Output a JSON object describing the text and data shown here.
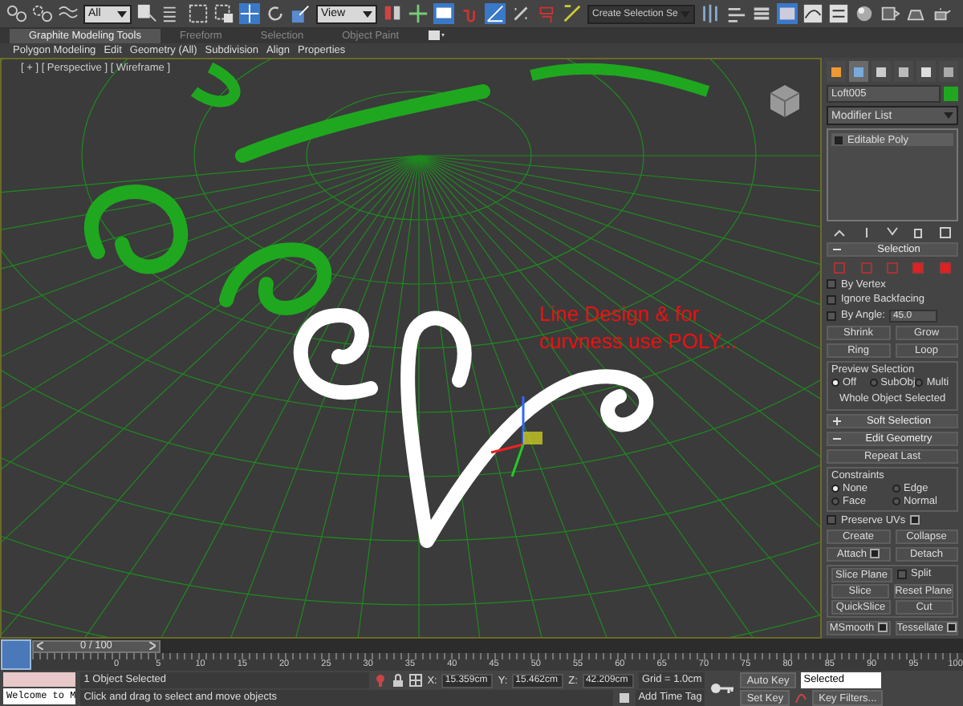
{
  "toolbar": {
    "selection_filter": "All",
    "reference_coordinate": "View",
    "named_selection": "Create Selection Se"
  },
  "ribbon": {
    "tabs": [
      {
        "label": "Graphite Modeling Tools",
        "selected": true
      },
      {
        "label": "Freeform",
        "selected": false
      },
      {
        "label": "Selection",
        "selected": false
      },
      {
        "label": "Object Paint",
        "selected": false
      }
    ],
    "panels": [
      "Polygon Modeling",
      "Edit",
      "Geometry (All)",
      "Subdivision",
      "Align",
      "Properties"
    ]
  },
  "viewport": {
    "label": "[ + ] [ Perspective ] [ Wireframe ]",
    "annotation": "Line Design & for curvness use POLY..."
  },
  "command_panel": {
    "tabs": [
      {
        "selected": false
      },
      {
        "selected": true
      },
      {
        "selected": false
      },
      {
        "selected": false
      },
      {
        "selected": false
      },
      {
        "selected": false
      }
    ],
    "object": {
      "name": "Loft005",
      "color": "#1fa81f"
    },
    "modifier_list": "Modifier List",
    "stack": [
      {
        "label": "Editable Poly",
        "selected": true
      }
    ],
    "selection": {
      "title": "Selection",
      "expanded": true,
      "checks": [
        {
          "label": "By Vertex",
          "checked": false
        },
        {
          "label": "Ignore Backfacing",
          "checked": false
        },
        {
          "label": "By Angle:",
          "checked": false
        }
      ],
      "angle": "45.0",
      "buttons": [
        [
          "Shrink",
          "Grow"
        ],
        [
          "Ring",
          "Loop"
        ]
      ],
      "preview_title": "Preview Selection",
      "preview": [
        {
          "label": "Off",
          "selected": true
        },
        {
          "label": "SubObj",
          "selected": false
        },
        {
          "label": "Multi",
          "selected": false
        }
      ],
      "info": "Whole Object Selected"
    },
    "soft_selection": {
      "title": "Soft Selection",
      "expanded": false
    },
    "edit_geometry": {
      "title": "Edit Geometry",
      "expanded": true,
      "repeat": "Repeat Last",
      "constraints_title": "Constraints",
      "constraints": [
        {
          "label": "None",
          "selected": true
        },
        {
          "label": "Edge",
          "selected": false
        },
        {
          "label": "Face",
          "selected": false
        },
        {
          "label": "Normal",
          "selected": false
        }
      ],
      "preserve_uvs": {
        "label": "Preserve UVs",
        "checked": false
      },
      "rows": [
        [
          {
            "label": "Create",
            "settings": false
          },
          {
            "label": "Collapse",
            "settings": false
          }
        ],
        [
          {
            "label": "Attach",
            "settings": true
          },
          {
            "label": "Detach",
            "settings": false
          }
        ]
      ],
      "slice_plane": "Slice Plane",
      "split": {
        "label": "Split",
        "checked": false
      },
      "slice_rows": [
        [
          "Slice",
          "Reset Plane"
        ],
        [
          "QuickSlice",
          "Cut"
        ]
      ],
      "bottom_row": [
        {
          "label": "MSmooth",
          "settings": true
        },
        {
          "label": "Tessellate",
          "settings": true
        }
      ]
    }
  },
  "timeline": {
    "position": "0 / 100",
    "level": 0,
    "ticks": [
      "0",
      "5",
      "10",
      "15",
      "20",
      "25",
      "30",
      "35",
      "40",
      "45",
      "50",
      "55",
      "60",
      "65",
      "70",
      "75",
      "80",
      "85",
      "90",
      "95",
      "100"
    ]
  },
  "status_bar": {
    "script_listener": "Welcome to M",
    "selection": "1 Object Selected",
    "prompt": "Click and drag to select and move objects",
    "coords": [
      {
        "axis": "X:",
        "value": "15.359cm"
      },
      {
        "axis": "Y:",
        "value": "15.462cm"
      },
      {
        "axis": "Z:",
        "value": "42.209cm"
      }
    ],
    "grid": "Grid = 1.0cm",
    "add_time_tag": "Add Time Tag",
    "auto_key": "Auto Key",
    "key_mode": "Selected",
    "set_key": "Set Key",
    "key_filters": "Key Filters..."
  }
}
